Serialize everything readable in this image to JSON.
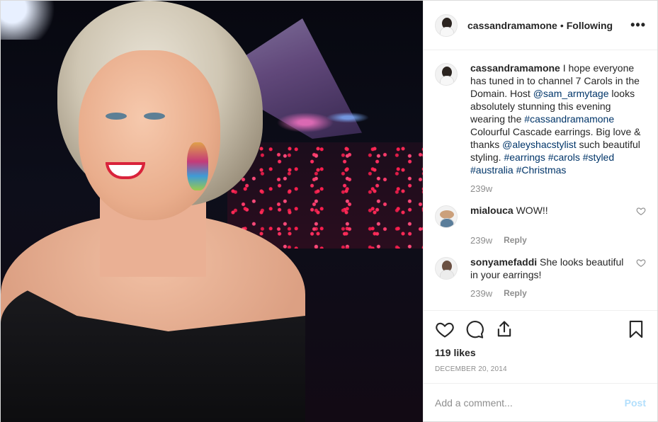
{
  "header": {
    "username": "cassandramamone",
    "separator": "•",
    "follow_state": "Following",
    "more_label": "•••"
  },
  "caption": {
    "username": "cassandramamone",
    "parts": [
      {
        "text": "I hope everyone has tuned in to channel 7 Carols in the Domain. Host ",
        "tag": false
      },
      {
        "text": "@sam_armytage",
        "tag": true
      },
      {
        "text": " looks absolutely stunning this evening wearing the ",
        "tag": false
      },
      {
        "text": "#cassandramamone",
        "tag": true
      },
      {
        "text": " Colourful Cascade earrings. Big love & thanks ",
        "tag": false
      },
      {
        "text": "@aleyshacstylist",
        "tag": true
      },
      {
        "text": " such beautiful styling. ",
        "tag": false
      },
      {
        "text": "#earrings",
        "tag": true
      },
      {
        "text": " ",
        "tag": false
      },
      {
        "text": "#carols",
        "tag": true
      },
      {
        "text": " ",
        "tag": false
      },
      {
        "text": "#styled",
        "tag": true
      },
      {
        "text": " ",
        "tag": false
      },
      {
        "text": "#australia",
        "tag": true
      },
      {
        "text": " ",
        "tag": false
      },
      {
        "text": "#Christmas",
        "tag": true
      }
    ],
    "time": "239w"
  },
  "comments": [
    {
      "username": "mialouca",
      "text": "WOW!!",
      "time": "239w",
      "reply_label": "Reply"
    },
    {
      "username": "sonyamefaddi",
      "text": "She looks beautiful in your earrings!",
      "time": "239w",
      "reply_label": "Reply"
    }
  ],
  "likes": "119 likes",
  "date": "DECEMBER 20, 2014",
  "add_comment": {
    "placeholder": "Add a comment...",
    "post_label": "Post"
  },
  "colors": {
    "link": "#003569",
    "muted": "#8e8e8e",
    "post_disabled": "#b2dffc"
  },
  "icons": [
    "heart-icon",
    "comment-icon",
    "share-icon",
    "bookmark-icon",
    "more-icon"
  ]
}
